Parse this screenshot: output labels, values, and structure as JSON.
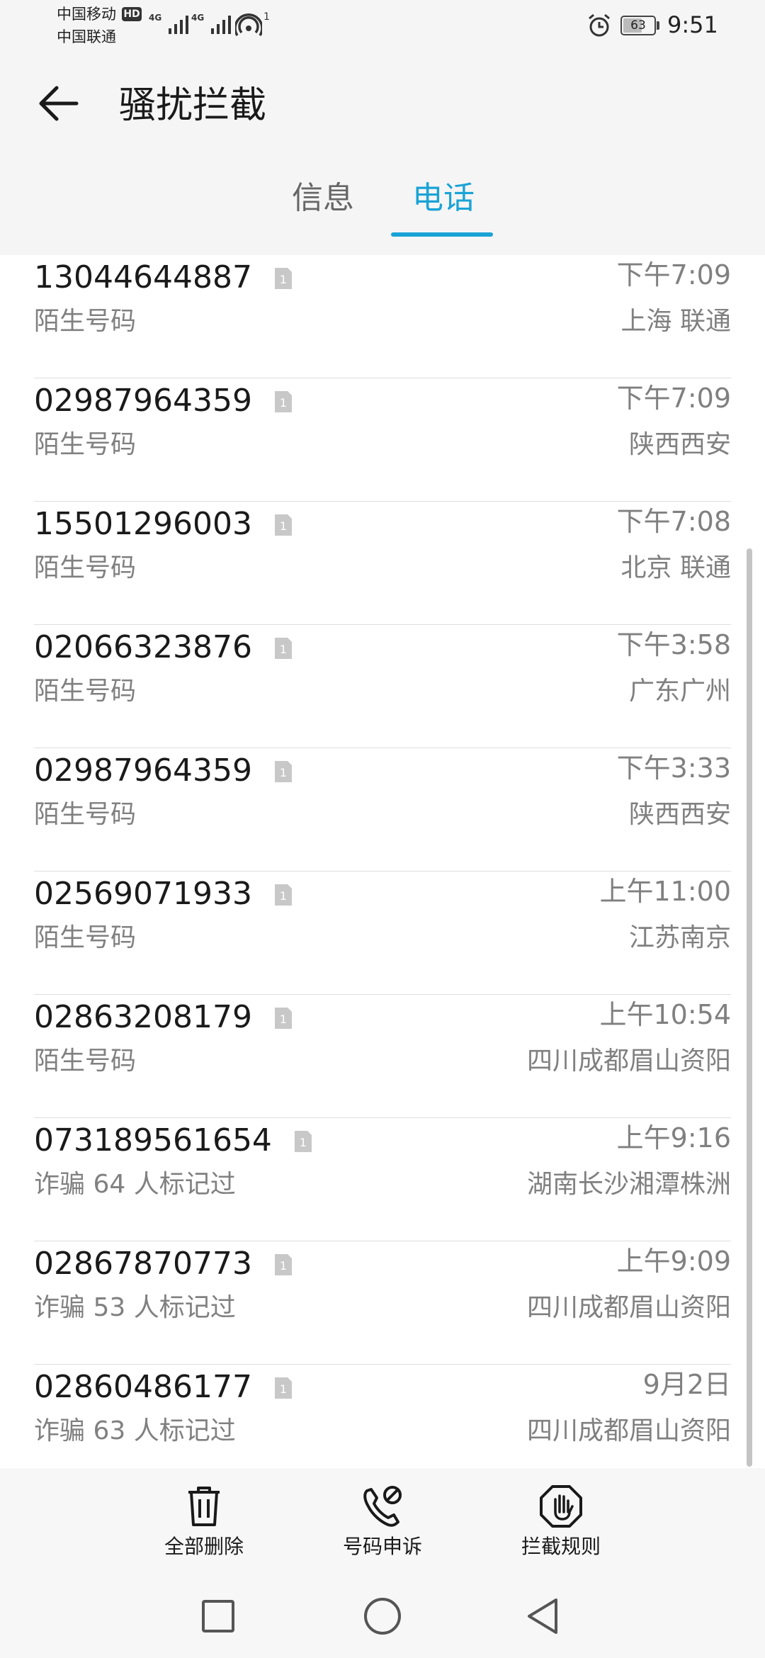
{
  "status_bar": {
    "carrier1": "中国移动",
    "hd": "HD",
    "carrier2": "中国联通",
    "net1": "4G",
    "net2": "4G",
    "wifi_count": "1",
    "battery": "63",
    "battery_level": 0.63,
    "time": "9:51"
  },
  "header": {
    "title": "骚扰拦截",
    "tabs": [
      "信息",
      "电话"
    ],
    "active_tab": "电话"
  },
  "calls": [
    {
      "number": "13044644887",
      "sub": "陌生号码",
      "time": "下午7:09",
      "location": "上海 联通"
    },
    {
      "number": "02987964359",
      "sub": "陌生号码",
      "time": "下午7:09",
      "location": "陕西西安"
    },
    {
      "number": "15501296003",
      "sub": "陌生号码",
      "time": "下午7:08",
      "location": "北京 联通"
    },
    {
      "number": "02066323876",
      "sub": "陌生号码",
      "time": "下午3:58",
      "location": "广东广州"
    },
    {
      "number": "02987964359",
      "sub": "陌生号码",
      "time": "下午3:33",
      "location": "陕西西安"
    },
    {
      "number": "02569071933",
      "sub": "陌生号码",
      "time": "上午11:00",
      "location": "江苏南京"
    },
    {
      "number": "02863208179",
      "sub": "陌生号码",
      "time": "上午10:54",
      "location": "四川成都眉山资阳"
    },
    {
      "number": "073189561654",
      "sub": "诈骗   64 人标记过",
      "time": "上午9:16",
      "location": "湖南长沙湘潭株洲"
    },
    {
      "number": "02867870773",
      "sub": "诈骗   53 人标记过",
      "time": "上午9:09",
      "location": "四川成都眉山资阳"
    },
    {
      "number": "02860486177",
      "sub": "诈骗   63 人标记过",
      "time": "9月2日",
      "location": "四川成都眉山资阳"
    }
  ],
  "sim_badge": "1",
  "actions": {
    "delete_all": "全部删除",
    "appeal": "号码申诉",
    "rules": "拦截规则"
  },
  "icons": {
    "back": "arrow-left-icon",
    "sim": "sim-card-icon",
    "delete": "trash-icon",
    "appeal": "phone-blocked-icon",
    "rules": "hand-stop-icon",
    "alarm": "alarm-clock-icon",
    "wifi": "hotspot-icon"
  },
  "colors": {
    "accent": "#1aa3d6",
    "secondary_text": "#808080",
    "header_bg": "#f5f5f5"
  }
}
